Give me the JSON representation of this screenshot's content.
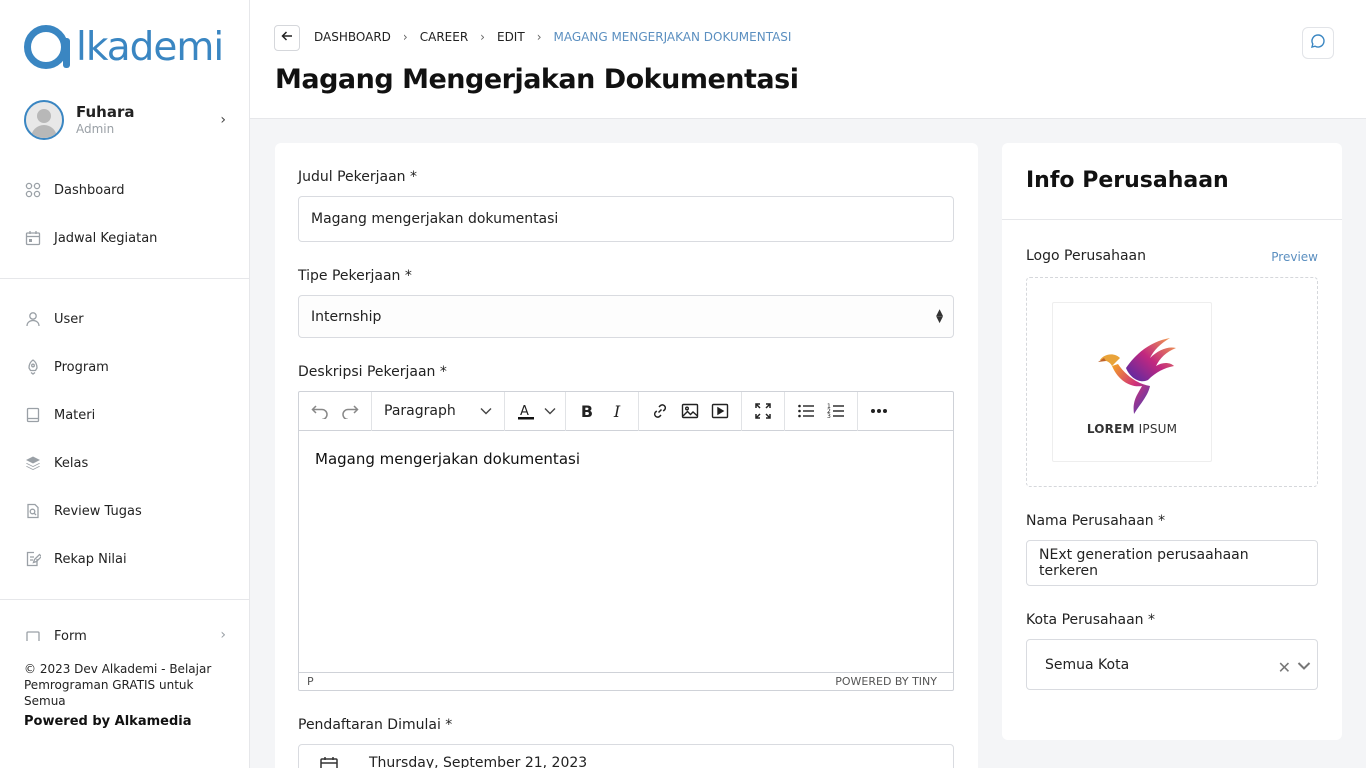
{
  "brand": {
    "logo_text": "lkademi",
    "color": "#3a86c2"
  },
  "profile": {
    "name": "Fuhara",
    "role": "Admin"
  },
  "sidebar": {
    "items_top": [
      {
        "label": "Dashboard",
        "icon": "grid-icon"
      },
      {
        "label": "Jadwal Kegiatan",
        "icon": "calendar-icon"
      }
    ],
    "items_mid": [
      {
        "label": "User",
        "icon": "user-icon"
      },
      {
        "label": "Program",
        "icon": "rocket-icon"
      },
      {
        "label": "Materi",
        "icon": "book-icon"
      },
      {
        "label": "Kelas",
        "icon": "layers-icon"
      },
      {
        "label": "Review Tugas",
        "icon": "search-doc-icon"
      },
      {
        "label": "Rekap Nilai",
        "icon": "edit-doc-icon"
      }
    ],
    "items_bottom": [
      {
        "label": "Form",
        "icon": "form-icon"
      }
    ],
    "footer": "© 2023 Dev Alkademi - Belajar Pemrograman GRATIS untuk Semua",
    "powered": "Powered by Alkamedia"
  },
  "breadcrumb": [
    "DASHBOARD",
    "CAREER",
    "EDIT",
    "MAGANG MENGERJAKAN DOKUMENTASI"
  ],
  "page_title": "Magang Mengerjakan Dokumentasi",
  "form": {
    "title_label": "Judul Pekerjaan *",
    "title_value": "Magang mengerjakan dokumentasi",
    "type_label": "Tipe Pekerjaan *",
    "type_value": "Internship",
    "desc_label": "Deskripsi Pekerjaan *",
    "editor": {
      "block_format": "Paragraph",
      "content": "Magang mengerjakan dokumentasi",
      "path": "P",
      "powered": "POWERED BY TINY"
    },
    "start_label": "Pendaftaran Dimulai *",
    "start_value": "Thursday, September 21, 2023"
  },
  "company": {
    "heading": "Info Perusahaan",
    "logo_label": "Logo Perusahaan",
    "preview_label": "Preview",
    "logo_text_bold": "LOREM",
    "logo_text_light": "IPSUM",
    "name_label": "Nama Perusahaan *",
    "name_value": "NExt generation perusaahaan terkeren",
    "city_label": "Kota Perusahaan *",
    "city_value": "Semua Kota"
  }
}
